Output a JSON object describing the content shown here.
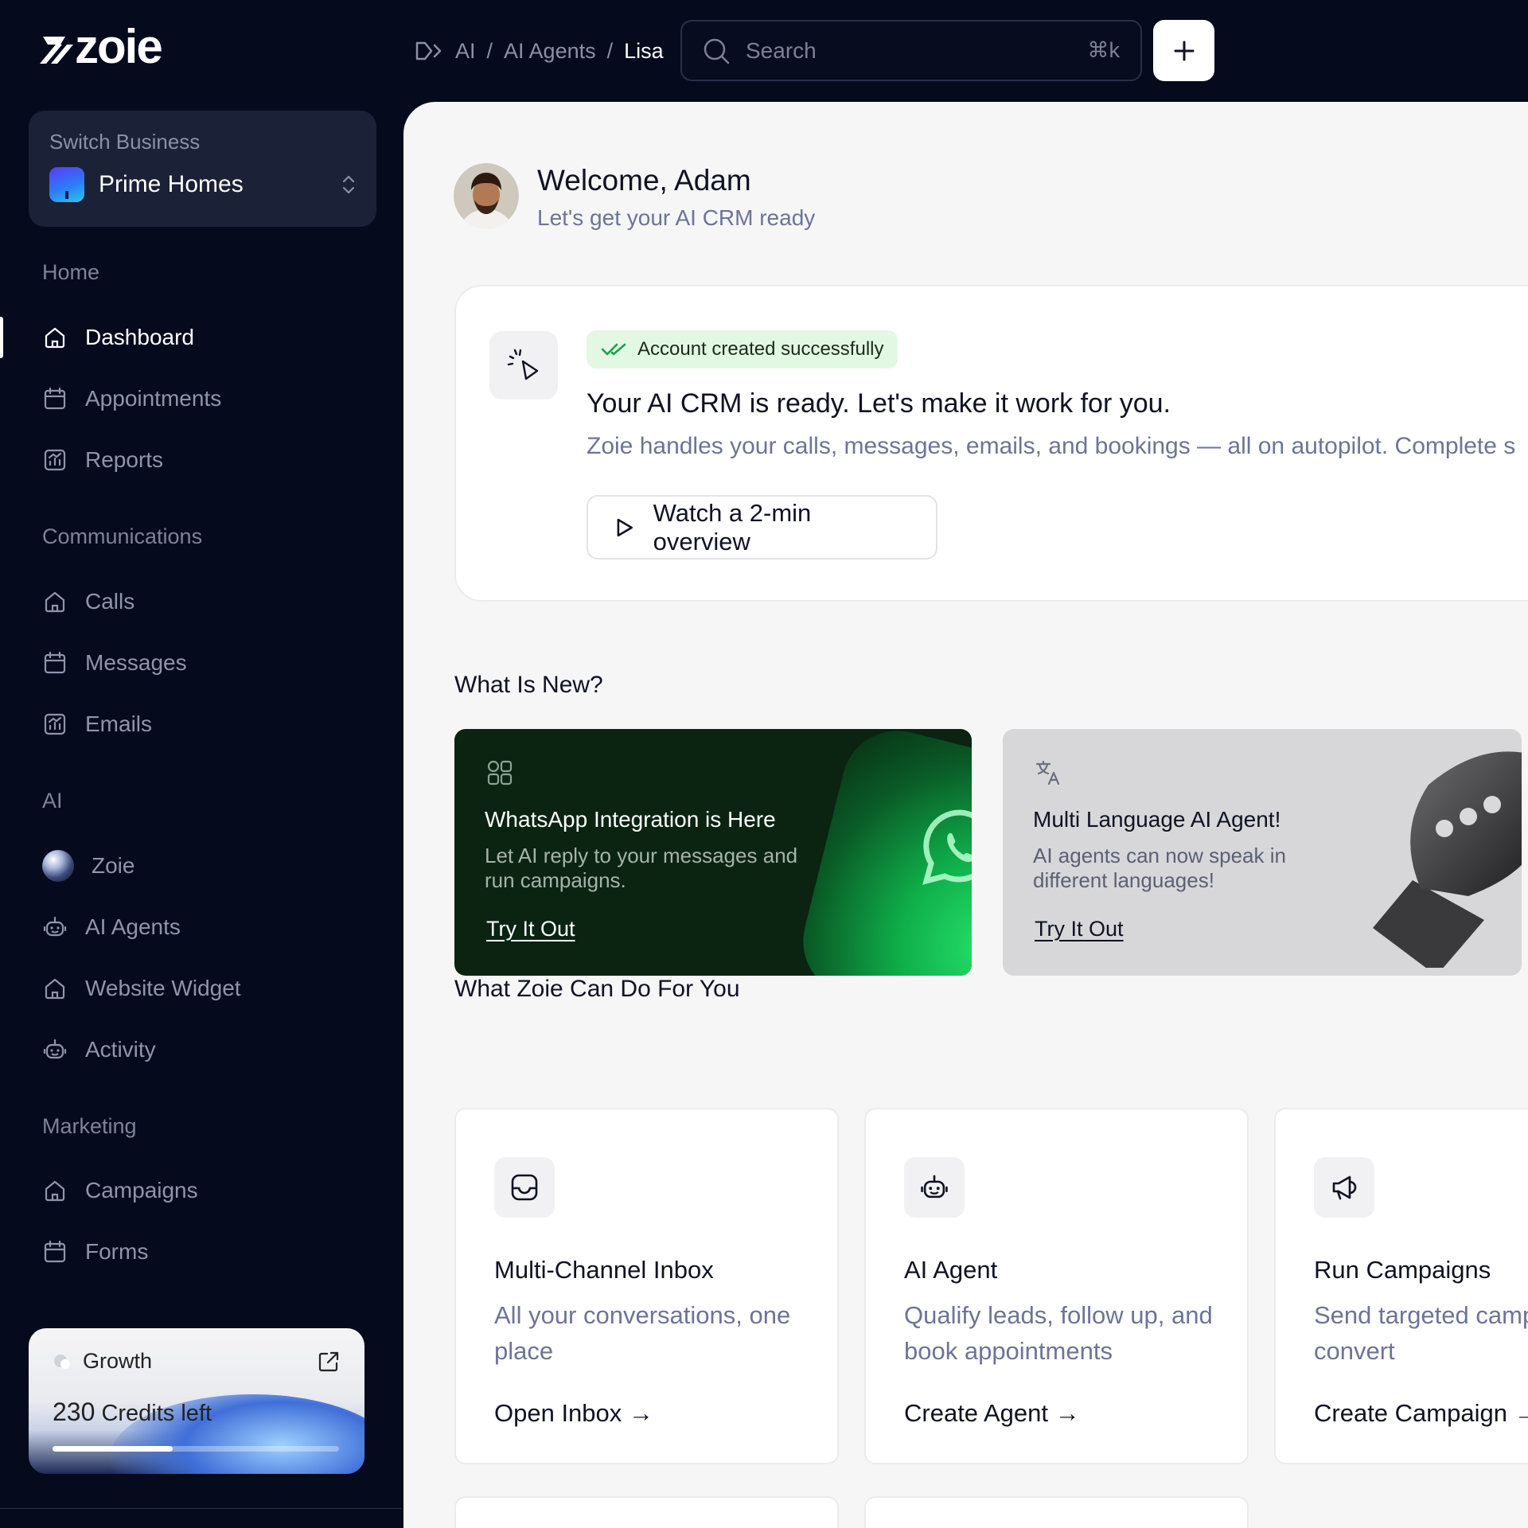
{
  "brand": {
    "name": "zoie"
  },
  "topbar": {
    "breadcrumb": [
      "AI",
      "AI Agents",
      "Lisa"
    ],
    "breadcrumb_sep": "/",
    "search_placeholder": "Search",
    "search_shortcut": "⌘k"
  },
  "sidebar": {
    "switch_label": "Switch Business",
    "business_name": "Prime Homes",
    "sections": [
      {
        "title": "Home",
        "items": [
          "Dashboard",
          "Appointments",
          "Reports"
        ]
      },
      {
        "title": "Communications",
        "items": [
          "Calls",
          "Messages",
          "Emails"
        ]
      },
      {
        "title": "AI",
        "items": [
          "Zoie",
          "AI Agents",
          "Website Widget",
          "Activity"
        ]
      },
      {
        "title": "Marketing",
        "items": [
          "Campaigns",
          "Forms"
        ]
      }
    ],
    "active_item": "Dashboard",
    "credits": {
      "plan": "Growth",
      "count": "230",
      "label": "Credits left",
      "progress": 0.42
    }
  },
  "main": {
    "welcome": "Welcome, Adam",
    "welcome_sub": "Let's get your AI CRM ready",
    "hero": {
      "badge": "Account created successfully",
      "title": "Your AI CRM is ready. Let's make it work for you.",
      "desc": "Zoie handles your calls, messages, emails, and bookings — all on autopilot. Complete s",
      "watch_label": "Watch a 2-min overview"
    },
    "whats_new_title": "What Is New?",
    "promos": [
      {
        "title": "WhatsApp Integration is Here",
        "desc": "Let AI reply to your messages and run campaigns.",
        "link": "Try It Out"
      },
      {
        "title": "Multi Language AI Agent!",
        "desc": "AI agents can now speak in different languages!",
        "link": "Try It Out"
      }
    ],
    "features_title": "What Zoie Can Do For You",
    "features": [
      {
        "title": "Multi-Channel Inbox",
        "desc": "All your conversations, one place",
        "link": "Open Inbox →"
      },
      {
        "title": "AI Agent",
        "desc": "Qualify leads, follow up, and book appointments",
        "link": "Create Agent →"
      },
      {
        "title": "Run Campaigns",
        "desc": "Send targeted campaigns that convert",
        "link": "Create Campaign →"
      }
    ]
  },
  "colors": {
    "sidebar_bg": "#050a1c",
    "accent_green": "#25d366",
    "muted_text": "#6d7496"
  }
}
